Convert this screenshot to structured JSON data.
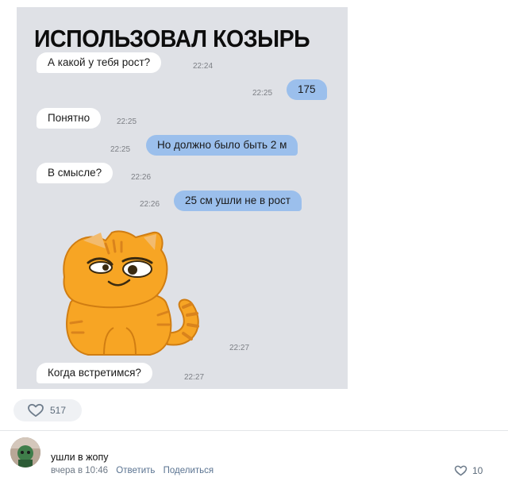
{
  "meme": {
    "title": "ИСПОЛЬЗОВАЛ КОЗЫРЬ",
    "messages": [
      {
        "side": "in",
        "text": "А какой у тебя рост?",
        "time": "22:24"
      },
      {
        "side": "out",
        "text": "175",
        "time": "22:25"
      },
      {
        "side": "in",
        "text": "Понятно",
        "time": "22:25"
      },
      {
        "side": "out",
        "text": "Но должно было быть 2 м",
        "time": "22:25"
      },
      {
        "side": "in",
        "text": "В смысле?",
        "time": "22:26"
      },
      {
        "side": "out",
        "text": "25 см ушли не в рост",
        "time": "22:26"
      },
      {
        "side": "in",
        "text": "Когда встретимся?",
        "time": "22:27"
      }
    ],
    "sticker_time": "22:27",
    "sticker": "smirking-orange-cat-sticker"
  },
  "post": {
    "like_count": "517",
    "like_icon": "heart-icon"
  },
  "comment": {
    "text": "ушли в жопу",
    "time": "вчера в 10:46",
    "reply_label": "Ответить",
    "share_label": "Поделиться",
    "like_count": "10",
    "like_icon": "heart-icon"
  },
  "colors": {
    "meme_background": "#dfe1e6",
    "incoming_bubble": "#ffffff",
    "outgoing_bubble": "#9bbfec",
    "cat_orange": "#f7a524",
    "meta_gray": "#6d7885"
  }
}
